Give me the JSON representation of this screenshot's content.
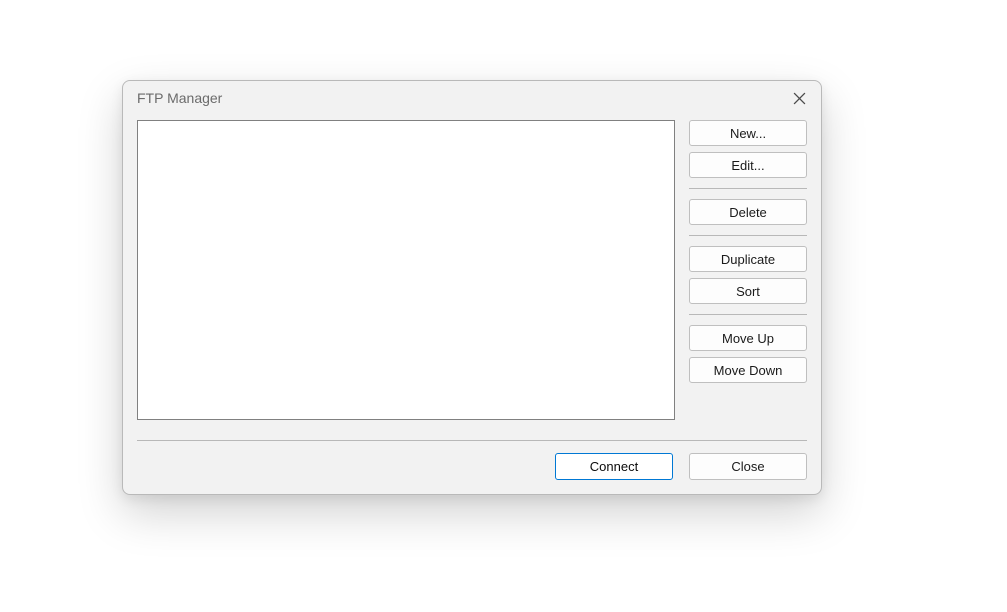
{
  "dialog": {
    "title": "FTP Manager",
    "buttons": {
      "new": "New...",
      "edit": "Edit...",
      "delete": "Delete",
      "duplicate": "Duplicate",
      "sort": "Sort",
      "move_up": "Move Up",
      "move_down": "Move Down",
      "connect": "Connect",
      "close": "Close"
    },
    "list_items": []
  }
}
